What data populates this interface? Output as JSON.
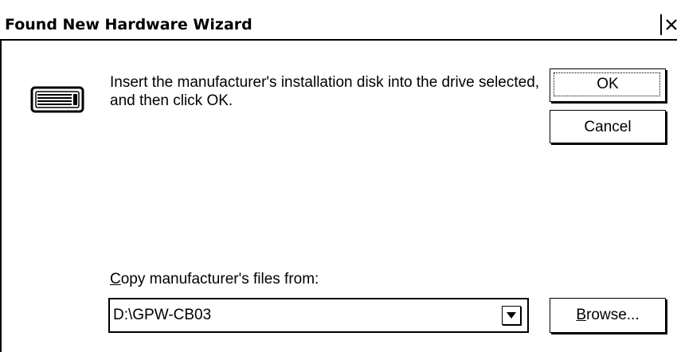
{
  "window": {
    "title": "Found New Hardware Wizard"
  },
  "icons": {
    "close": "close-icon",
    "disk": "disk-drive-icon",
    "dropdown": "chevron-down-icon"
  },
  "message": {
    "text": "Insert the manufacturer's installation disk into the drive selected, and then click OK."
  },
  "buttons": {
    "ok_label": "OK",
    "cancel_label": "Cancel",
    "browse_label_accel": "B",
    "browse_label_rest": "rowse..."
  },
  "copy_from": {
    "label_accel": "C",
    "label_rest": "opy manufacturer's files from:",
    "value": "D:\\GPW-CB03"
  }
}
